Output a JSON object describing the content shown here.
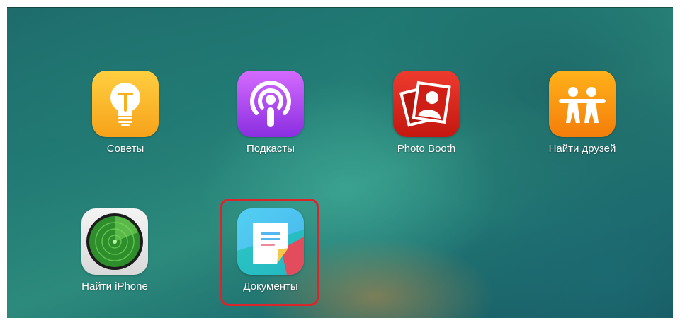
{
  "home_screen": {
    "apps": [
      {
        "name": "tips",
        "label": "Советы",
        "icon": "lightbulb-icon",
        "color": "#f7a21a"
      },
      {
        "name": "podcasts",
        "label": "Подкасты",
        "icon": "podcasts-icon",
        "color": "#8a2ee0"
      },
      {
        "name": "photo-booth",
        "label": "Photo Booth",
        "icon": "photo-booth-icon",
        "color": "#c3170f"
      },
      {
        "name": "find-friends",
        "label": "Найти друзей",
        "icon": "find-friends-icon",
        "color": "#f47d0a"
      },
      {
        "name": "find-iphone",
        "label": "Найти iPhone",
        "icon": "radar-icon",
        "color": "#1e7a2a"
      },
      {
        "name": "documents",
        "label": "Документы",
        "icon": "documents-icon",
        "color": "#2b8fe0"
      }
    ],
    "highlighted_app": "documents",
    "highlight_color": "#d9252c"
  }
}
